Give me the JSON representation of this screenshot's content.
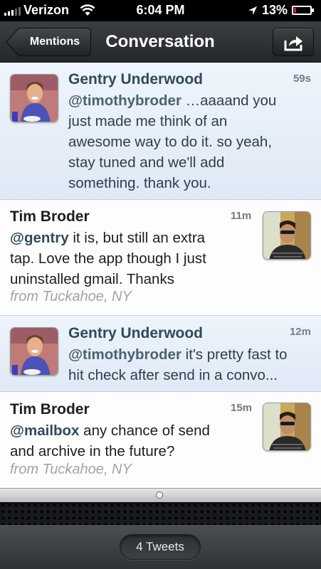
{
  "status_bar": {
    "carrier": "Verizon",
    "time": "6:04 PM",
    "battery": "13%",
    "battery_level": 0.13,
    "signal_bars": 3,
    "icons": [
      "signal-icon",
      "wifi-icon",
      "location-arrow-icon",
      "battery-icon"
    ]
  },
  "nav": {
    "back_label": "Mentions",
    "title": "Conversation",
    "share_icon": "share-icon"
  },
  "tweets": [
    {
      "name": "Gentry Underwood",
      "age": "59s",
      "mention": "@timothybroder",
      "body_line1": " …aaaand you",
      "body_line2": "just made me think of an",
      "body_line3": "awesome way to do it. so yeah,",
      "body_line4": "stay tuned and we'll add",
      "body_line5": "something. thank you."
    },
    {
      "name": "Tim Broder",
      "age": "11m",
      "mention": "@gentry",
      "body_line1": " it is, but still an extra",
      "body_line2": "tap. Love the app though I just",
      "body_line3": "uninstalled gmail. Thanks",
      "location": "from Tuckahoe, NY"
    },
    {
      "name": "Gentry Underwood",
      "age": "12m",
      "mention": "@timothybroder",
      "body_line1": " it's pretty fast to",
      "body_line2": "hit check after send in a convo..."
    },
    {
      "name": "Tim Broder",
      "age": "15m",
      "mention": "@mailbox",
      "body_line1": " any chance of send",
      "body_line2": "and archive in the future?",
      "location": "from Tuckahoe, NY"
    }
  ],
  "toolbar": {
    "tweet_count": "4 Tweets"
  }
}
